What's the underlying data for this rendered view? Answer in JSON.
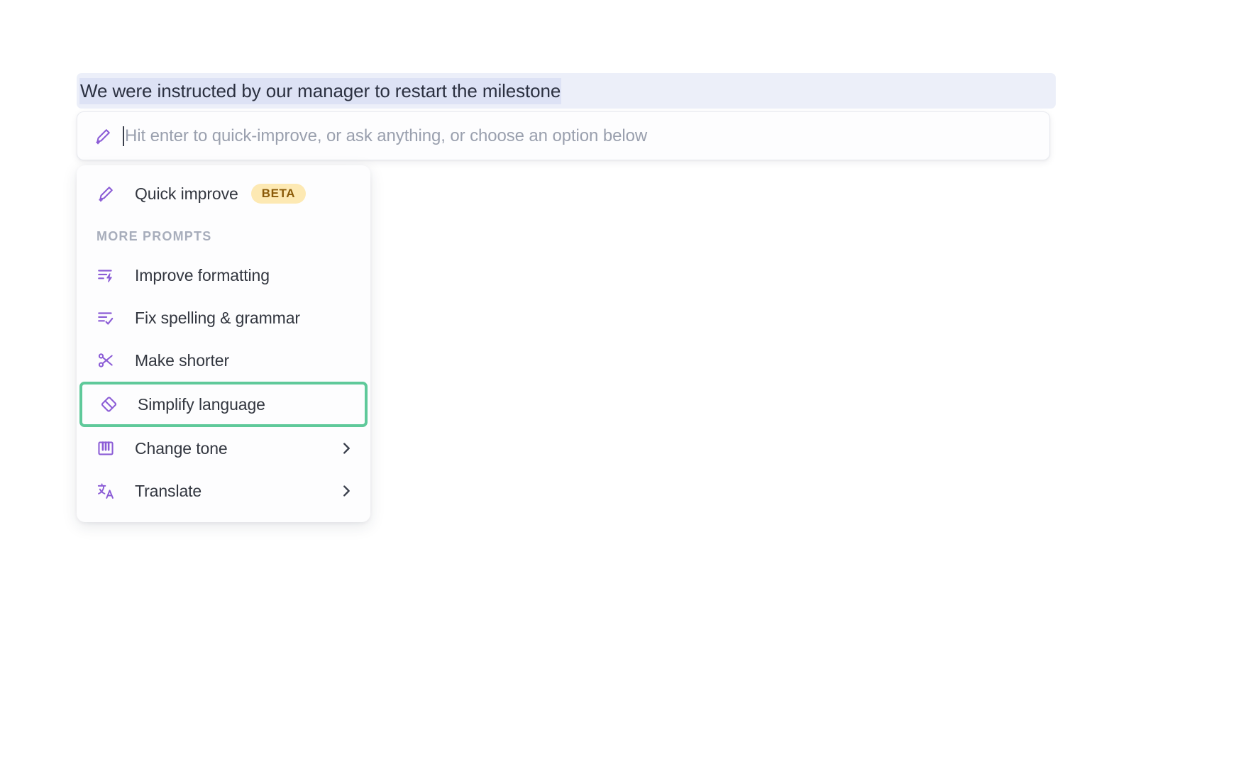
{
  "document": {
    "selected_text": "We were instructed by our manager to restart the milestone"
  },
  "prompt_input": {
    "placeholder": "Hit enter to quick-improve, or ask anything, or choose an option below",
    "value": "",
    "icon": "magic-pen-icon"
  },
  "menu": {
    "primary": {
      "label": "Quick improve",
      "badge": "BETA",
      "icon": "magic-pen-icon"
    },
    "section_header": "MORE PROMPTS",
    "items": [
      {
        "label": "Improve formatting",
        "icon": "format-lightning-icon",
        "has_submenu": false,
        "highlighted": false
      },
      {
        "label": "Fix spelling & grammar",
        "icon": "spellcheck-icon",
        "has_submenu": false,
        "highlighted": false
      },
      {
        "label": "Make shorter",
        "icon": "scissors-icon",
        "has_submenu": false,
        "highlighted": false
      },
      {
        "label": "Simplify language",
        "icon": "eraser-icon",
        "has_submenu": false,
        "highlighted": true
      },
      {
        "label": "Change tone",
        "icon": "piano-keys-icon",
        "has_submenu": true,
        "highlighted": false
      },
      {
        "label": "Translate",
        "icon": "translate-icon",
        "has_submenu": true,
        "highlighted": false
      }
    ]
  },
  "colors": {
    "accent_purple": "#8b5cd6",
    "highlight_green": "#5fc99a",
    "badge_bg": "#fde9b3",
    "badge_text": "#8a5a08",
    "selection_bg": "#dde2f5",
    "text_bar_bg": "#eceff9"
  }
}
